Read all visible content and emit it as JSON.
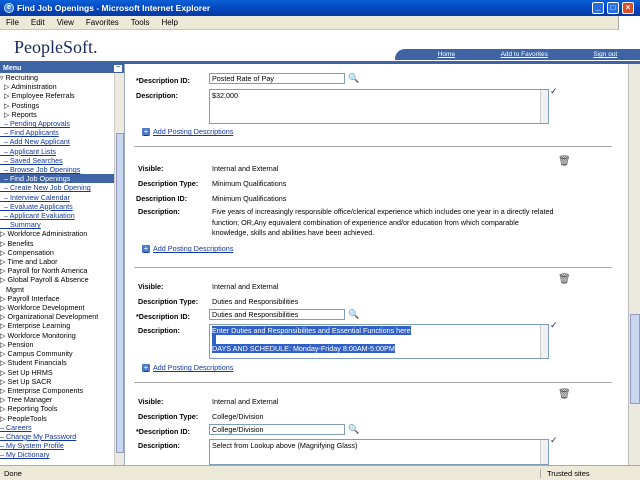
{
  "window": {
    "title": "Find Job Openings - Microsoft Internet Explorer"
  },
  "menubar": [
    "File",
    "Edit",
    "View",
    "Favorites",
    "Tools",
    "Help"
  ],
  "header": {
    "logo": "PeopleSoft.",
    "links": [
      "Home",
      "Add to Favorites",
      "Sign out"
    ]
  },
  "menu": {
    "title": "Menu",
    "items": [
      {
        "t": "▿ Recruiting",
        "k": "n"
      },
      {
        "t": "  ▷ Administration",
        "k": "n"
      },
      {
        "t": "  ▷ Employee Referrals",
        "k": "n"
      },
      {
        "t": "  ▷ Postings",
        "k": "n"
      },
      {
        "t": "  ▷ Reports",
        "k": "n"
      },
      {
        "t": "  – Pending Approvals",
        "k": "l"
      },
      {
        "t": "  – Find Applicants",
        "k": "l"
      },
      {
        "t": "  – Add New Applicant",
        "k": "l"
      },
      {
        "t": "  – Applicant Lists",
        "k": "l"
      },
      {
        "t": "  – Saved Searches",
        "k": "l"
      },
      {
        "t": "  – Browse Job Openings",
        "k": "l"
      },
      {
        "t": "  – Find Job Openings",
        "k": "s"
      },
      {
        "t": "  – Create New Job Opening",
        "k": "l"
      },
      {
        "t": "  – Interview Calendar",
        "k": "l"
      },
      {
        "t": "  – Evaluate Applicants",
        "k": "l"
      },
      {
        "t": "  – Applicant Evaluation",
        "k": "l"
      },
      {
        "t": "     Summary",
        "k": "l"
      },
      {
        "t": "▷ Workforce Administration",
        "k": "n"
      },
      {
        "t": "▷ Benefits",
        "k": "n"
      },
      {
        "t": "▷ Compensation",
        "k": "n"
      },
      {
        "t": "▷ Time and Labor",
        "k": "n"
      },
      {
        "t": "▷ Payroll for North America",
        "k": "n"
      },
      {
        "t": "▷ Global Payroll & Absence",
        "k": "n"
      },
      {
        "t": "   Mgmt",
        "k": "n"
      },
      {
        "t": "▷ Payroll Interface",
        "k": "n"
      },
      {
        "t": "▷ Workforce Development",
        "k": "n"
      },
      {
        "t": "▷ Organizational Development",
        "k": "n"
      },
      {
        "t": "▷ Enterprise Learning",
        "k": "n"
      },
      {
        "t": "▷ Workforce Monitoring",
        "k": "n"
      },
      {
        "t": "▷ Pension",
        "k": "n"
      },
      {
        "t": "▷ Campus Community",
        "k": "n"
      },
      {
        "t": "▷ Student Financials",
        "k": "n"
      },
      {
        "t": "▷ Set Up HRMS",
        "k": "n"
      },
      {
        "t": "▷ Set Up SACR",
        "k": "n"
      },
      {
        "t": "▷ Enterprise Components",
        "k": "n"
      },
      {
        "t": "▷ Tree Manager",
        "k": "n"
      },
      {
        "t": "▷ Reporting Tools",
        "k": "n"
      },
      {
        "t": "▷ PeopleTools",
        "k": "n"
      },
      {
        "t": "– Careers",
        "k": "l"
      },
      {
        "t": "– Change My Password",
        "k": "l"
      },
      {
        "t": "– My System Profile",
        "k": "l"
      },
      {
        "t": "– My Dictionary",
        "k": "l"
      }
    ]
  },
  "labels": {
    "desc_id_req": "*Description ID:",
    "desc_id": "Description ID:",
    "description": "Description:",
    "visible": "Visible:",
    "desc_type": "Description Type:",
    "add_posting": "Add Posting Descriptions"
  },
  "card1": {
    "desc_id": "Posted Rate of Pay",
    "description": "$32,000"
  },
  "card2": {
    "visible": "Internal and External",
    "desc_type": "Minimum Qualifications",
    "desc_id": "Minimum Qualifications",
    "description": "Five years of increasingly responsible office/clerical experience which includes one year in a directly related function; OR,Any equivalent combination of experience and/or education from which comparable knowledge, skills and abilities have been achieved."
  },
  "card3": {
    "visible": "Internal and External",
    "desc_type": "Duties and Responsibilities",
    "desc_id": "Duties and Responsibilities",
    "line1": "Enter Duties and Responsibilites and Essential Functions here",
    "line2": "DAYS AND SCHEDULE: Monday-Friday 8:00AM-5:00PM"
  },
  "card4": {
    "visible": "Internal and External",
    "desc_type": "College/Division",
    "desc_id": "College/Division",
    "description": "Select from Lookup above (Magnifying Glass)"
  },
  "status": {
    "left": "Done",
    "zone": "Trusted sites"
  }
}
